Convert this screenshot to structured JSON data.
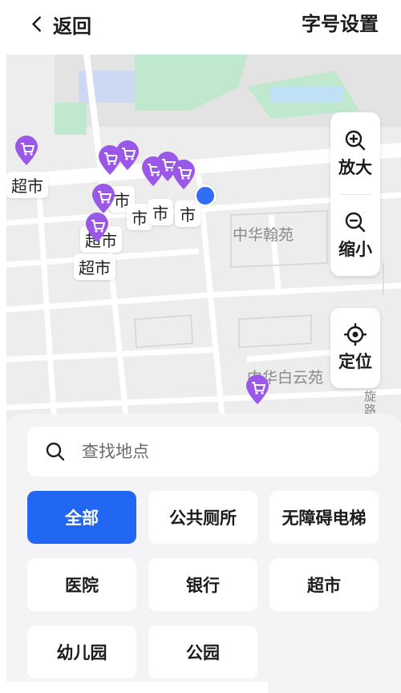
{
  "header": {
    "back_label": "返回",
    "font_setting_label": "字号设置"
  },
  "map": {
    "zoom_in_label": "放大",
    "zoom_out_label": "缩小",
    "locate_label": "定位",
    "place_names": {
      "p1": "中华翰苑",
      "p2": "中华白云苑",
      "road_vertical": "旋路"
    },
    "poi_labels": [
      "超市",
      "超市",
      "超市",
      "市",
      "市",
      "市",
      "市"
    ],
    "colors": {
      "pin": "#9b57e8",
      "green": "#bfe8cf",
      "water": "#bfe0f5",
      "road": "#ffffff",
      "land": "#ededed",
      "user": "#2f6ef6"
    }
  },
  "search": {
    "placeholder": "查找地点"
  },
  "categories": [
    {
      "label": "全部",
      "active": true
    },
    {
      "label": "公共厕所",
      "active": false
    },
    {
      "label": "无障碍电梯",
      "active": false
    },
    {
      "label": "医院",
      "active": false
    },
    {
      "label": "银行",
      "active": false
    },
    {
      "label": "超市",
      "active": false
    },
    {
      "label": "幼儿园",
      "active": false
    },
    {
      "label": "公园",
      "active": false
    }
  ],
  "accent_color": "#2267f2"
}
